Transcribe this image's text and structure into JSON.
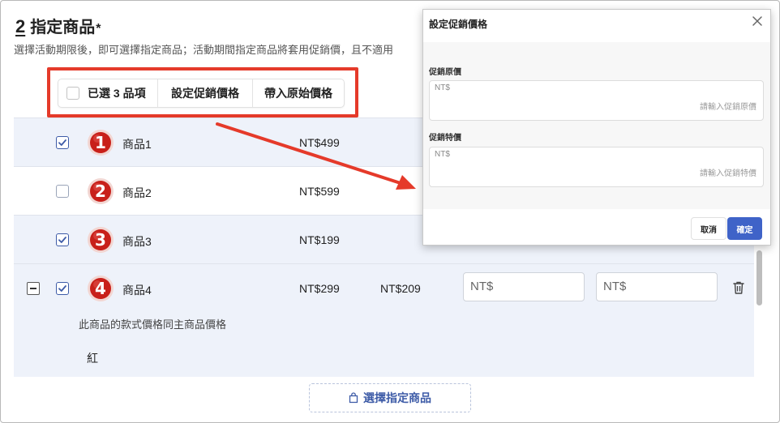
{
  "section": {
    "number": "2",
    "title": "指定商品",
    "required_mark": "*",
    "description": "選擇活動期限後，即可選擇指定商品；活動期間指定商品將套用促銷價，且不適用"
  },
  "action_bar": {
    "selected_label": "已選 3 品項",
    "set_price_label": "設定促銷價格",
    "import_price_label": "帶入原始價格"
  },
  "products": [
    {
      "badge": "1",
      "name": "商品1",
      "price": "NT$499",
      "checked": true
    },
    {
      "badge": "2",
      "name": "商品2",
      "price": "NT$599",
      "checked": false
    },
    {
      "badge": "3",
      "name": "商品3",
      "price": "NT$199",
      "checked": true
    },
    {
      "badge": "4",
      "name": "商品4",
      "price": "NT$299",
      "sale_price": "NT$209",
      "checked": true,
      "original_input": "NT$",
      "special_input": "NT$",
      "variant_note": "此商品的款式價格同主商品價格",
      "variant_name": "紅"
    }
  ],
  "select_products_button": "選擇指定商品",
  "modal": {
    "title": "設定促銷價格",
    "original_label": "促銷原價",
    "original_prefix": "NT$",
    "original_placeholder": "請輸入促銷原價",
    "special_label": "促銷特價",
    "special_prefix": "NT$",
    "special_placeholder": "請輸入促銷特價",
    "cancel_label": "取消",
    "confirm_label": "確定"
  },
  "colors": {
    "annotation_red": "#e53a2a",
    "primary_blue": "#3f63c8",
    "badge_red": "#c8201a",
    "selected_row_bg": "#eef2fa"
  }
}
